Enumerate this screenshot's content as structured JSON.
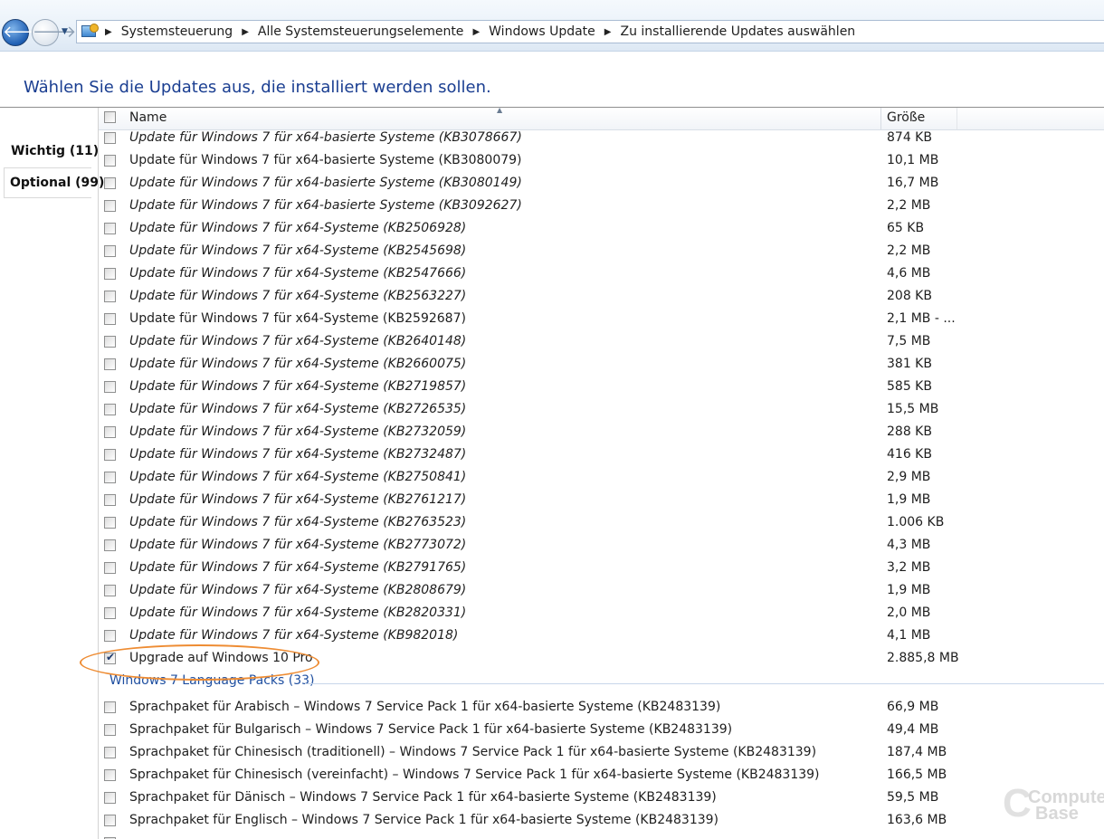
{
  "address_bar": {
    "breadcrumbs": [
      "Systemsteuerung",
      "Alle Systemsteuerungselemente",
      "Windows Update",
      "Zu installierende Updates auswählen"
    ]
  },
  "heading": "Wählen Sie die Updates aus, die installiert werden sollen.",
  "tabs": [
    {
      "label": "Wichtig (11)"
    },
    {
      "label": "Optional (99)"
    }
  ],
  "columns": {
    "name": "Name",
    "size": "Größe"
  },
  "rows": [
    {
      "name": "Update für Windows 7 für x64-basierte Systeme (KB3078667)",
      "size": "874 KB",
      "italic": true,
      "checked": false
    },
    {
      "name": "Update für Windows 7 für x64-basierte Systeme (KB3080079)",
      "size": "10,1 MB",
      "italic": false,
      "checked": false
    },
    {
      "name": "Update für Windows 7 für x64-basierte Systeme (KB3080149)",
      "size": "16,7 MB",
      "italic": true,
      "checked": false
    },
    {
      "name": "Update für Windows 7 für x64-basierte Systeme (KB3092627)",
      "size": "2,2 MB",
      "italic": true,
      "checked": false
    },
    {
      "name": "Update für Windows 7 für x64-Systeme (KB2506928)",
      "size": "65 KB",
      "italic": true,
      "checked": false
    },
    {
      "name": "Update für Windows 7 für x64-Systeme (KB2545698)",
      "size": "2,2 MB",
      "italic": true,
      "checked": false
    },
    {
      "name": "Update für Windows 7 für x64-Systeme (KB2547666)",
      "size": "4,6 MB",
      "italic": true,
      "checked": false
    },
    {
      "name": "Update für Windows 7 für x64-Systeme (KB2563227)",
      "size": "208 KB",
      "italic": true,
      "checked": false
    },
    {
      "name": "Update für Windows 7 für x64-Systeme (KB2592687)",
      "size": "2,1 MB - ...",
      "italic": false,
      "checked": false
    },
    {
      "name": "Update für Windows 7 für x64-Systeme (KB2640148)",
      "size": "7,5 MB",
      "italic": true,
      "checked": false
    },
    {
      "name": "Update für Windows 7 für x64-Systeme (KB2660075)",
      "size": "381 KB",
      "italic": true,
      "checked": false
    },
    {
      "name": "Update für Windows 7 für x64-Systeme (KB2719857)",
      "size": "585 KB",
      "italic": true,
      "checked": false
    },
    {
      "name": "Update für Windows 7 für x64-Systeme (KB2726535)",
      "size": "15,5 MB",
      "italic": true,
      "checked": false
    },
    {
      "name": "Update für Windows 7 für x64-Systeme (KB2732059)",
      "size": "288 KB",
      "italic": true,
      "checked": false
    },
    {
      "name": "Update für Windows 7 für x64-Systeme (KB2732487)",
      "size": "416 KB",
      "italic": true,
      "checked": false
    },
    {
      "name": "Update für Windows 7 für x64-Systeme (KB2750841)",
      "size": "2,9 MB",
      "italic": true,
      "checked": false
    },
    {
      "name": "Update für Windows 7 für x64-Systeme (KB2761217)",
      "size": "1,9 MB",
      "italic": true,
      "checked": false
    },
    {
      "name": "Update für Windows 7 für x64-Systeme (KB2763523)",
      "size": "1.006 KB",
      "italic": true,
      "checked": false
    },
    {
      "name": "Update für Windows 7 für x64-Systeme (KB2773072)",
      "size": "4,3 MB",
      "italic": true,
      "checked": false
    },
    {
      "name": "Update für Windows 7 für x64-Systeme (KB2791765)",
      "size": "3,2 MB",
      "italic": true,
      "checked": false
    },
    {
      "name": "Update für Windows 7 für x64-Systeme (KB2808679)",
      "size": "1,9 MB",
      "italic": true,
      "checked": false
    },
    {
      "name": "Update für Windows 7 für x64-Systeme (KB2820331)",
      "size": "2,0 MB",
      "italic": true,
      "checked": false
    },
    {
      "name": "Update für Windows 7 für x64-Systeme (KB982018)",
      "size": "4,1 MB",
      "italic": true,
      "checked": false
    },
    {
      "name": "Upgrade auf Windows 10 Pro",
      "size": "2.885,8 MB",
      "italic": false,
      "checked": true
    }
  ],
  "group": {
    "label": "Windows 7 Language Packs (33)"
  },
  "language_rows": [
    {
      "name": "Sprachpaket für Arabisch – Windows 7 Service Pack 1 für x64-basierte Systeme (KB2483139)",
      "size": "66,9 MB"
    },
    {
      "name": "Sprachpaket für Bulgarisch – Windows 7 Service Pack 1 für x64-basierte Systeme (KB2483139)",
      "size": "49,4 MB"
    },
    {
      "name": "Sprachpaket für Chinesisch (traditionell) – Windows 7 Service Pack 1 für x64-basierte Systeme (KB2483139)",
      "size": "187,4 MB"
    },
    {
      "name": "Sprachpaket für Chinesisch (vereinfacht) – Windows 7 Service Pack 1 für x64-basierte Systeme (KB2483139)",
      "size": "166,5 MB"
    },
    {
      "name": "Sprachpaket für Dänisch – Windows 7 Service Pack 1 für x64-basierte Systeme (KB2483139)",
      "size": "59,5 MB"
    },
    {
      "name": "Sprachpaket für Englisch – Windows 7 Service Pack 1 für x64-basierte Systeme (KB2483139)",
      "size": "163,6 MB"
    }
  ],
  "watermark": {
    "line1": "Computer",
    "line2": "Base"
  }
}
